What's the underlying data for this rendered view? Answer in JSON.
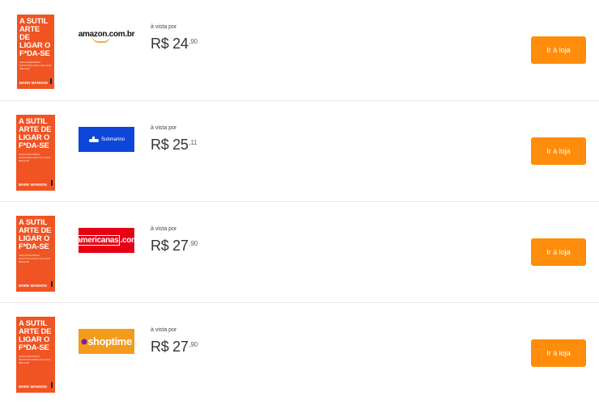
{
  "offers": [
    {
      "book": {
        "title": "A SUTIL ARTE DE LIGAR O F*DA-SE",
        "subtitle": "UMA ESTRATÉGIA INUSITADA PARA UMA VIDA MELHOR",
        "author": "MARK MANSON"
      },
      "store": {
        "name": "amazon.com.br",
        "logo_text": "amazon.com.br"
      },
      "price_label": "à vista por",
      "price_main": "R$ 24",
      "price_cents": ",90",
      "button_label": "Ir à loja"
    },
    {
      "book": {
        "title": "A SUTIL ARTE DE LIGAR O F*DA-SE",
        "subtitle": "UMA ESTRATÉGIA INUSITADA PARA UMA VIDA MELHOR",
        "author": "MARK MANSON"
      },
      "store": {
        "name": "Submarino",
        "logo_text": "Submarino"
      },
      "price_label": "à vista por",
      "price_main": "R$ 25",
      "price_cents": ",11",
      "button_label": "Ir à loja"
    },
    {
      "book": {
        "title": "A SUTIL ARTE DE LIGAR O F*DA-SE",
        "subtitle": "UMA ESTRATÉGIA INUSITADA PARA UMA VIDA MELHOR",
        "author": "MARK MANSON"
      },
      "store": {
        "name": "americanas.com",
        "logo_text_a": "americanas",
        "logo_text_b": ".com"
      },
      "price_label": "à vista por",
      "price_main": "R$ 27",
      "price_cents": ",90",
      "button_label": "Ir à loja"
    },
    {
      "book": {
        "title": "A SUTIL ARTE DE LIGAR O F*DA-SE",
        "subtitle": "UMA ESTRATÉGIA INUSITADA PARA UMA VIDA MELHOR",
        "author": "MARK MANSON"
      },
      "store": {
        "name": "shoptime",
        "logo_text": "shoptime"
      },
      "price_label": "à vista por",
      "price_main": "R$ 27",
      "price_cents": ",90",
      "button_label": "Ir à loja"
    }
  ],
  "colors": {
    "button": "#ff8c0a",
    "book_cover": "#f05423",
    "submarino": "#0e46d9",
    "americanas": "#e60014",
    "shoptime": "#f59b1c"
  }
}
